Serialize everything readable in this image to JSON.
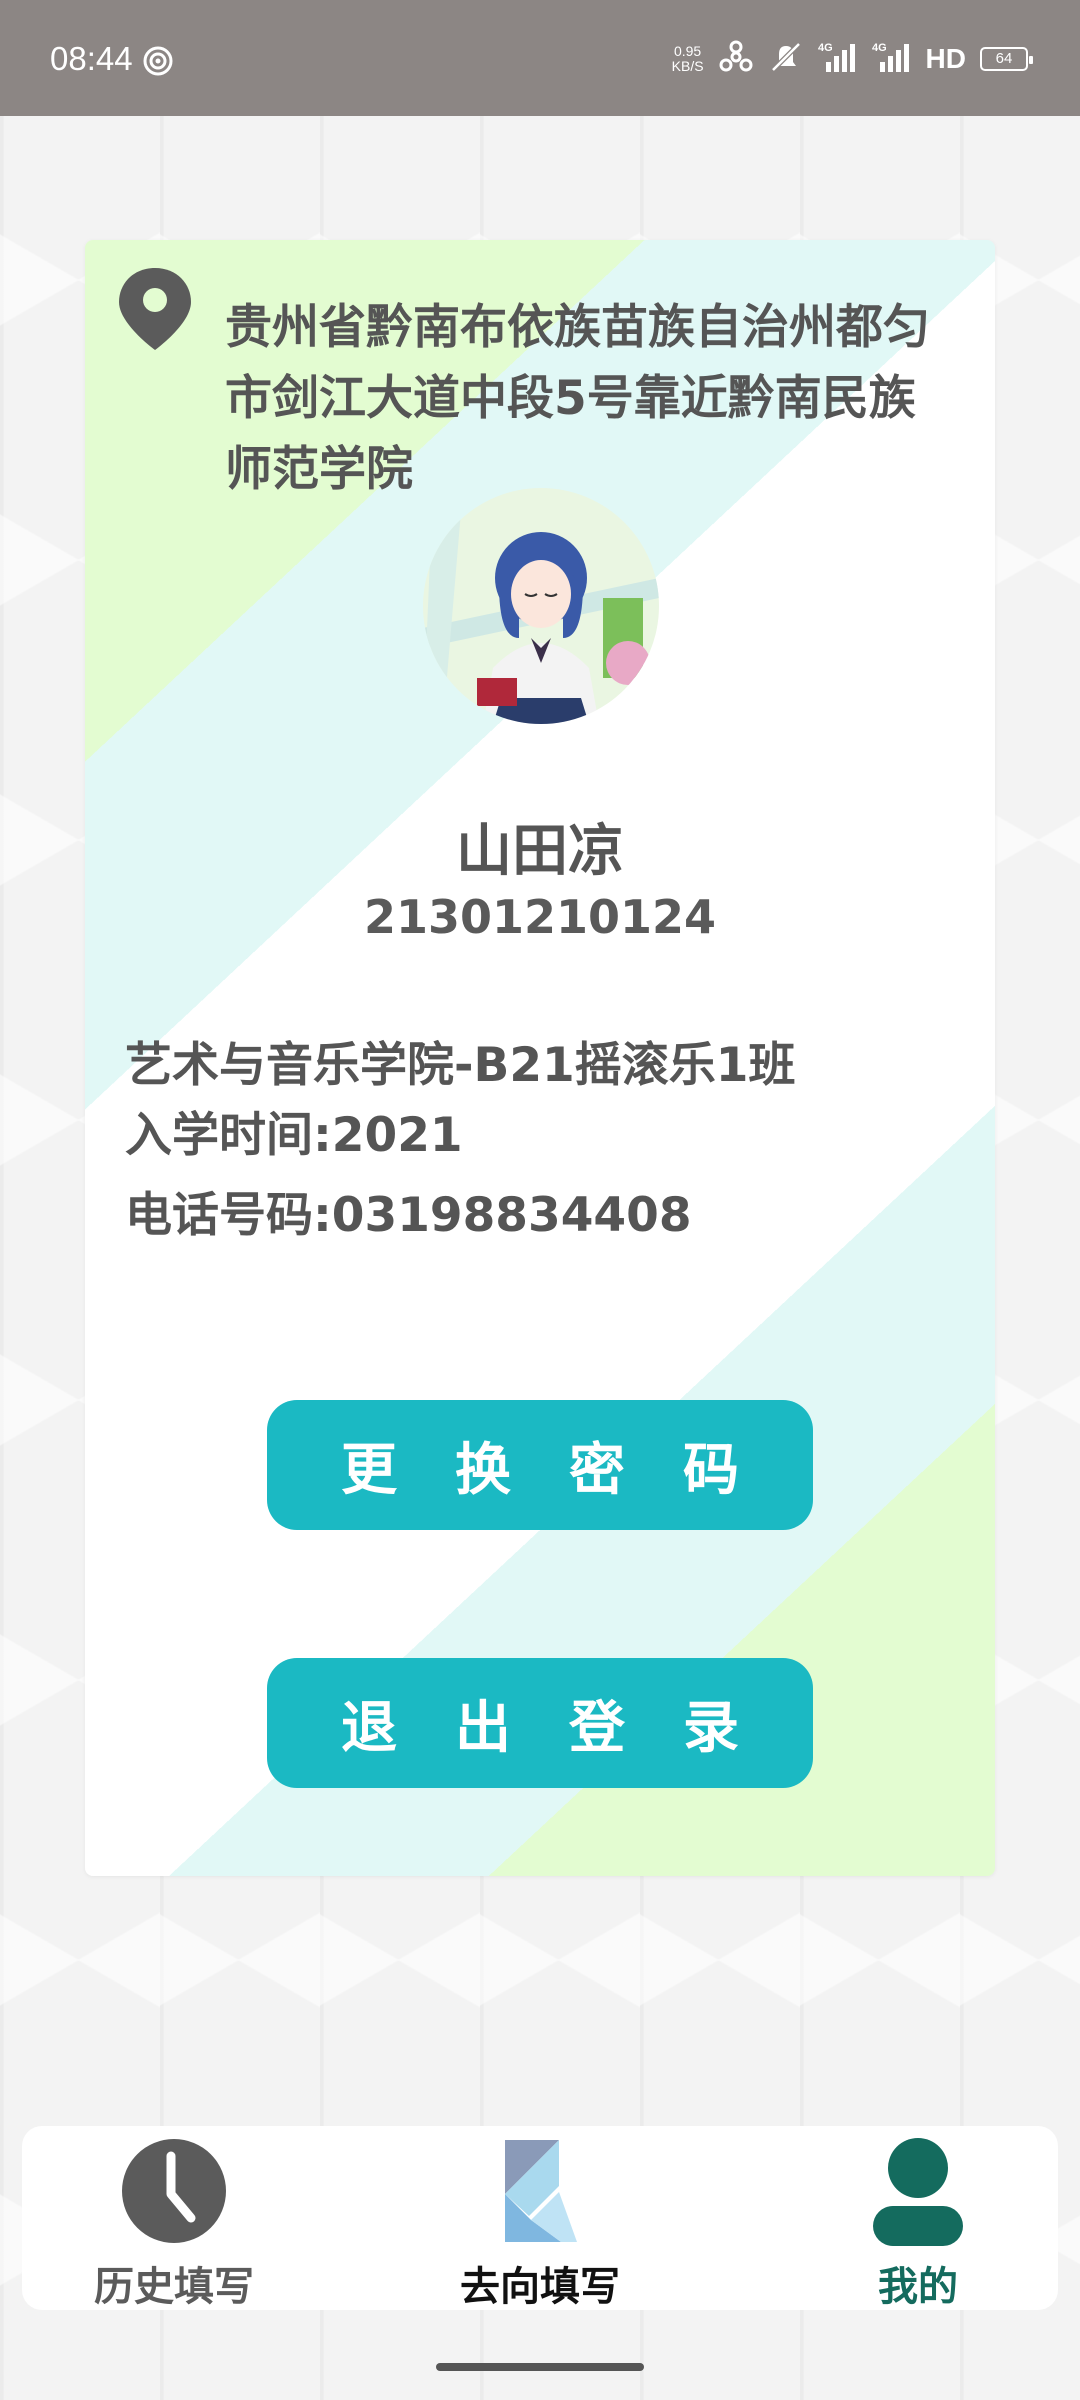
{
  "status_bar": {
    "time": "08:44",
    "net_speed_value": "0.95",
    "net_speed_unit": "KB/S",
    "hd_label": "HD",
    "battery": "64"
  },
  "profile": {
    "address": "贵州省黔南布依族苗族自治州都匀市剑江大道中段5号靠近黔南民族师范学院",
    "name": "山田凉",
    "student_id": "21301210124",
    "class_info": "艺术与音乐学院-B21摇滚乐1班",
    "enrollment": "入学时间:2021",
    "phone": "电话号码:03198834408"
  },
  "buttons": {
    "change_password": "更换密码",
    "logout": "退出登录"
  },
  "nav": {
    "history": "历史填写",
    "fill_destination": "去向填写",
    "mine": "我的"
  },
  "colors": {
    "accent": "#1bb9c3",
    "active_nav": "#146b5e",
    "text": "#555555"
  },
  "icons": {
    "location": "location-pin-icon",
    "history": "clock-icon",
    "fill": "kotlin-logo-icon",
    "mine": "person-icon"
  }
}
